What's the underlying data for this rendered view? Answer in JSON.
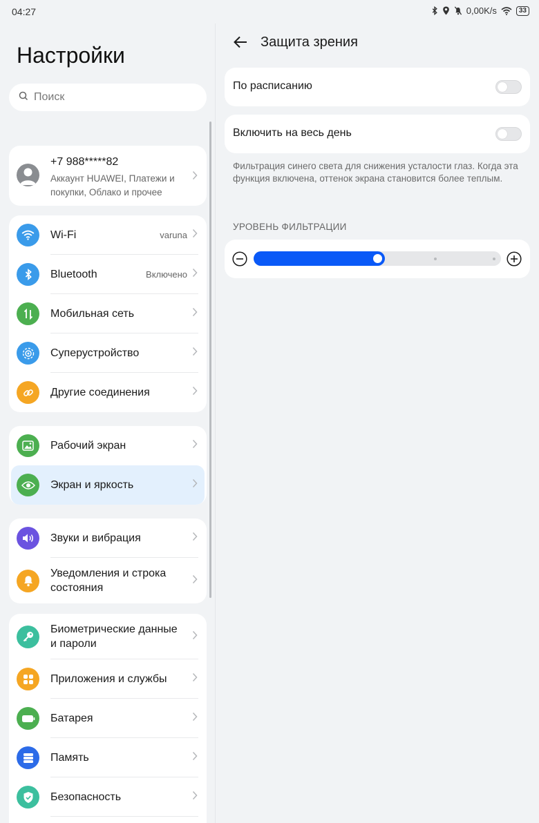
{
  "status_bar": {
    "time": "04:27",
    "net_speed": "0,00K/s",
    "battery": "33"
  },
  "left": {
    "title": "Настройки",
    "search_placeholder": "Поиск",
    "account": {
      "phone": "+7 988*****82",
      "subtitle": "Аккаунт HUAWEI, Платежи и покупки, Облако и прочее"
    },
    "groups": [
      [
        {
          "label": "Wi-Fi",
          "value": "varuna",
          "icon": "wifi-icon",
          "color": "#3a9bea"
        },
        {
          "label": "Bluetooth",
          "value": "Включено",
          "icon": "bluetooth-icon",
          "color": "#3a9bea"
        },
        {
          "label": "Мобильная сеть",
          "value": "",
          "icon": "mobile-network-icon",
          "color": "#4caf50"
        },
        {
          "label": "Суперустройство",
          "value": "",
          "icon": "superdevice-icon",
          "color": "#3a9bea"
        },
        {
          "label": "Другие соединения",
          "value": "",
          "icon": "link-icon",
          "color": "#f5a623"
        }
      ],
      [
        {
          "label": "Рабочий экран",
          "value": "",
          "icon": "home-screen-icon",
          "color": "#4caf50"
        },
        {
          "label": "Экран и яркость",
          "value": "",
          "icon": "eye-icon",
          "color": "#4caf50",
          "selected": true
        }
      ],
      [
        {
          "label": "Звуки и вибрация",
          "value": "",
          "icon": "sound-icon",
          "color": "#6b53e0"
        },
        {
          "label": "Уведомления и строка состояния",
          "value": "",
          "icon": "bell-icon",
          "color": "#f5a623"
        }
      ],
      [
        {
          "label": "Биометрические данные и пароли",
          "value": "",
          "icon": "key-icon",
          "color": "#3cbf9e"
        },
        {
          "label": "Приложения и службы",
          "value": "",
          "icon": "apps-icon",
          "color": "#f5a623"
        },
        {
          "label": "Батарея",
          "value": "",
          "icon": "battery-icon",
          "color": "#4caf50"
        },
        {
          "label": "Память",
          "value": "",
          "icon": "storage-icon",
          "color": "#2c6be8"
        },
        {
          "label": "Безопасность",
          "value": "",
          "icon": "shield-icon",
          "color": "#3cbf9e"
        }
      ]
    ]
  },
  "right": {
    "title": "Защита зрения",
    "schedule_label": "По расписанию",
    "schedule_on": false,
    "all_day_label": "Включить на весь день",
    "all_day_on": false,
    "description": "Фильтрация синего света для снижения усталости глаз. Когда эта функция включена, оттенок экрана становится более теплым.",
    "filter_heading": "УРОВЕНЬ ФИЛЬТРАЦИИ",
    "filter_level": 0.5,
    "filter_steps": 5
  },
  "colors": {
    "accent": "#0a59f7",
    "selected_row": "#e3f0fd"
  }
}
